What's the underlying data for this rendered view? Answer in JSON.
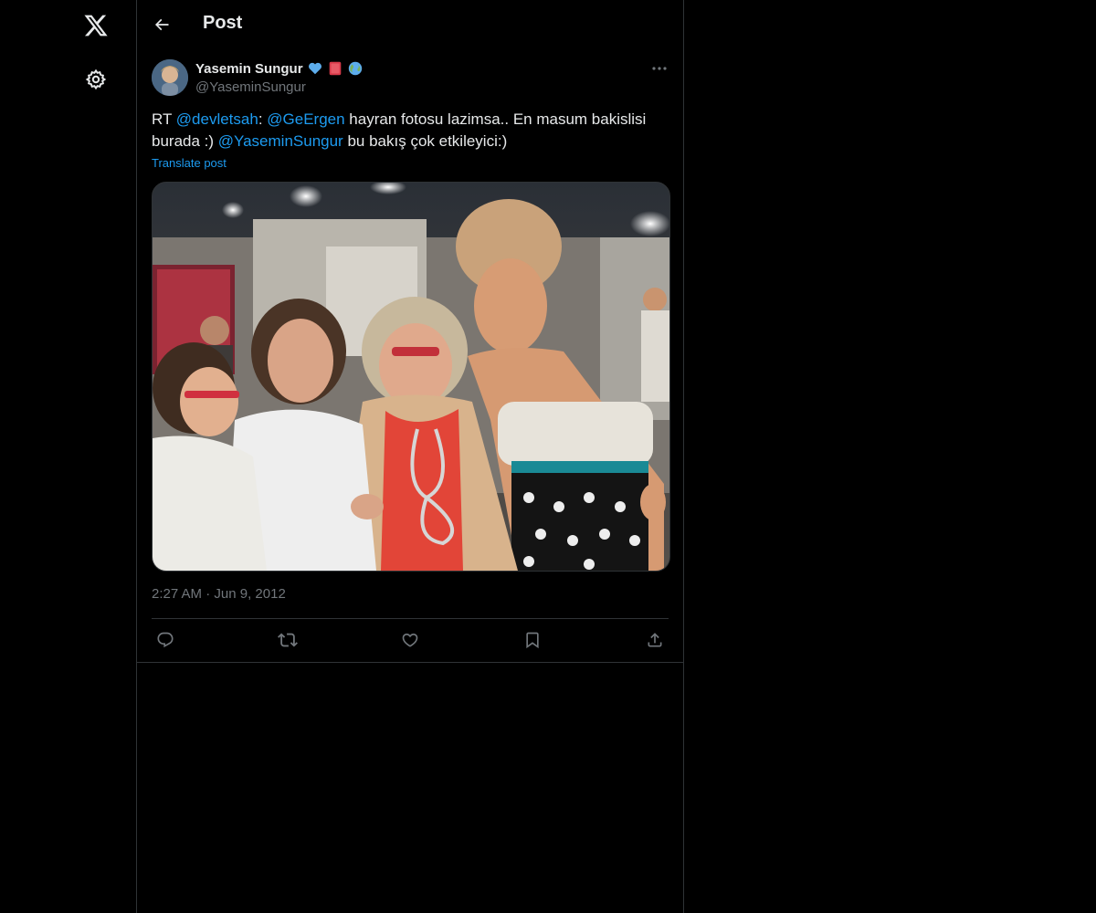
{
  "header": {
    "title": "Post"
  },
  "post": {
    "author_name": "Yasemin Sungur",
    "author_handle": "@YaseminSungur",
    "badges": [
      "blue-heart-emoji",
      "red-book-emoji",
      "globe-emoji"
    ],
    "text": {
      "prefix": "RT ",
      "mention1": "@devletsah",
      "after_mention1": ": ",
      "mention2": "@GeErgen",
      "after_mention2": " hayran fotosu lazimsa.. En masum bakislisi burada :)  ",
      "mention3": "@YaseminSungur",
      "suffix": " bu bakış çok etkileyici:)"
    },
    "translate_label": "Translate post",
    "time": "2:27 AM",
    "separator": "·",
    "date": "Jun 9, 2012"
  },
  "icons": {
    "logo": "x-logo-icon",
    "settings": "gear-icon",
    "back": "arrow-left-icon",
    "more": "more-horizontal-icon",
    "reply": "reply-icon",
    "repost": "repost-icon",
    "like": "heart-icon",
    "bookmark": "bookmark-icon",
    "share": "share-icon"
  },
  "colors": {
    "background": "#000000",
    "text": "#e7e9ea",
    "muted": "#71767b",
    "accent": "#1d9bf0",
    "border": "#2f3336"
  }
}
